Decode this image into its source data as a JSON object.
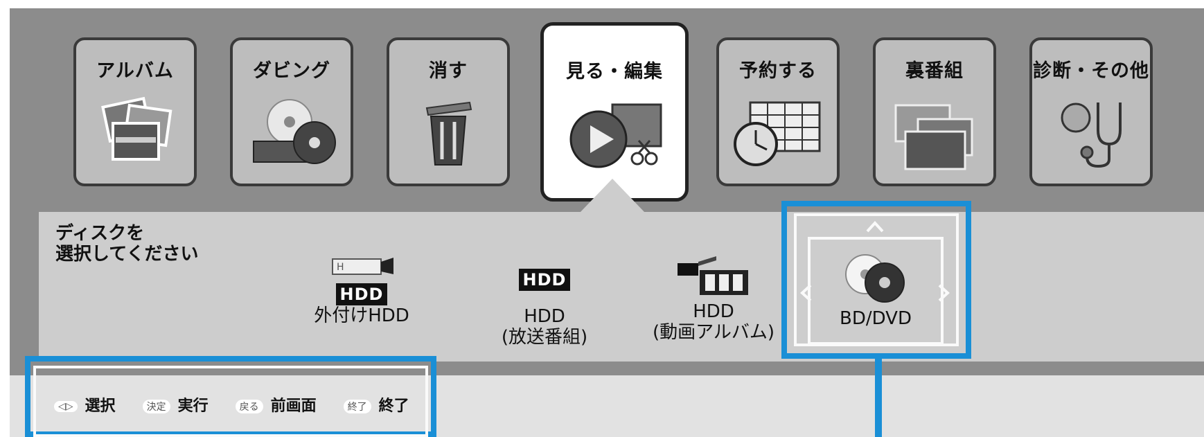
{
  "menu": [
    {
      "label": "アルバム",
      "icon": "photo-album-icon",
      "selected": false
    },
    {
      "label": "ダビング",
      "icon": "dubbing-disc-icon",
      "selected": false
    },
    {
      "label": "消す",
      "icon": "trash-can-icon",
      "selected": false
    },
    {
      "label": "見る・編集",
      "icon": "play-edit-icon",
      "selected": true
    },
    {
      "label": "予約する",
      "icon": "clock-schedule-icon",
      "selected": false
    },
    {
      "label": "裏番組",
      "icon": "tv-screens-icon",
      "selected": false
    },
    {
      "label": "診断・その他",
      "icon": "diagnostics-icon",
      "selected": false
    }
  ],
  "prompt": {
    "line1": "ディスクを",
    "line2": "選択してください"
  },
  "disks": [
    {
      "badge": "HDD",
      "small": "H",
      "label": "外付けHDD",
      "label2": ""
    },
    {
      "badge": "HDD",
      "label": "HDD",
      "label2": "(放送番組)"
    },
    {
      "label": "HDD",
      "label2": "(動画アルバム)"
    },
    {
      "label": "BD/DVD",
      "label2": ""
    }
  ],
  "hints": [
    {
      "key": "◁▷",
      "label": "選択"
    },
    {
      "key": "決定",
      "label": "実行"
    },
    {
      "key": "戻る",
      "label": "前画面"
    },
    {
      "key": "終了",
      "label": "終了"
    }
  ],
  "colors": {
    "accent": "#1a8fd6"
  }
}
